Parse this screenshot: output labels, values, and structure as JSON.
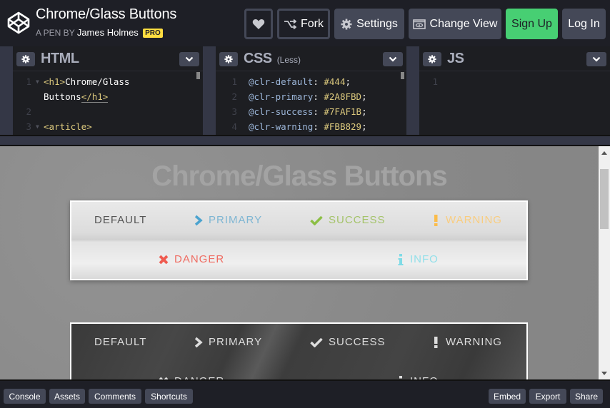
{
  "header": {
    "pen_title": "Chrome/Glass Buttons",
    "byline_prefix": "A PEN BY",
    "author": "James Holmes",
    "author_badge": "PRO",
    "buttons": {
      "fork": "Fork",
      "settings": "Settings",
      "change_view": "Change View",
      "sign_up": "Sign Up",
      "log_in": "Log In"
    }
  },
  "editors": {
    "html": {
      "title": "HTML",
      "lines": [
        {
          "num": "1",
          "open": "<h1>",
          "text": "Chrome/Glass",
          "cont": "Buttons",
          "close": "</h1>"
        },
        {
          "num": "2"
        },
        {
          "num": "3",
          "open": "<article>"
        }
      ]
    },
    "css": {
      "title": "CSS",
      "subtitle": "(Less)",
      "lines": [
        {
          "num": "1",
          "var": "@clr-default",
          "val": "#444"
        },
        {
          "num": "2",
          "var": "@clr-primary",
          "val": "#2A8FBD"
        },
        {
          "num": "3",
          "var": "@clr-success",
          "val": "#7FAF1B"
        },
        {
          "num": "4",
          "var": "@clr-warning",
          "val": "#FBB829"
        }
      ]
    },
    "js": {
      "title": "JS",
      "lines": [
        {
          "num": "1"
        }
      ]
    }
  },
  "preview": {
    "heading": "Chrome/Glass Buttons",
    "light_buttons": [
      {
        "label": "DEFAULT",
        "icon": "none",
        "color": "#555555"
      },
      {
        "label": "PRIMARY",
        "icon": "chevron-right",
        "color": "#7fb6d3"
      },
      {
        "label": "SUCCESS",
        "icon": "check",
        "color": "#a4c36a"
      },
      {
        "label": "WARNING",
        "icon": "exclamation",
        "color": "#f9cd80"
      },
      {
        "label": "DANGER",
        "icon": "times",
        "color": "#ef6c62"
      },
      {
        "label": "INFO",
        "icon": "info",
        "color": "#93e0ea"
      }
    ],
    "dark_buttons": [
      {
        "label": "DEFAULT",
        "icon": "none"
      },
      {
        "label": "PRIMARY",
        "icon": "chevron-right"
      },
      {
        "label": "SUCCESS",
        "icon": "check"
      },
      {
        "label": "WARNING",
        "icon": "exclamation"
      },
      {
        "label": "DANGER",
        "icon": "times"
      },
      {
        "label": "INFO",
        "icon": "info"
      }
    ]
  },
  "footer": {
    "left": [
      "Console",
      "Assets",
      "Comments",
      "Shortcuts"
    ],
    "right": [
      "Embed",
      "Export",
      "Share"
    ]
  }
}
